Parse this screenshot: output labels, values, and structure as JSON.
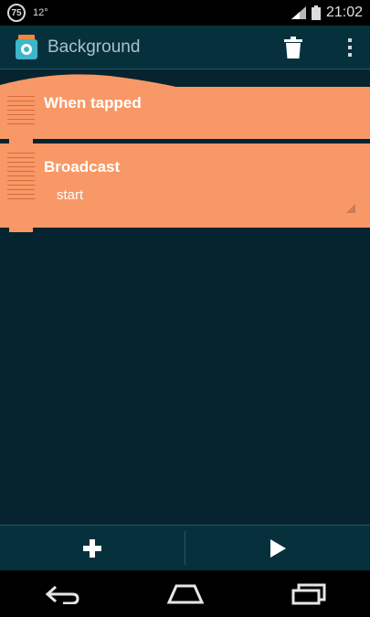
{
  "status_bar": {
    "badge": "75",
    "temperature": "12°",
    "time": "21:02"
  },
  "action_bar": {
    "title": "Background"
  },
  "bricks": [
    {
      "type": "when_tapped",
      "label": "When tapped"
    },
    {
      "type": "broadcast",
      "label": "Broadcast",
      "selected_message": "start"
    }
  ],
  "colors": {
    "brick": "#f89866",
    "background": "#062430",
    "bar": "#07303d"
  }
}
